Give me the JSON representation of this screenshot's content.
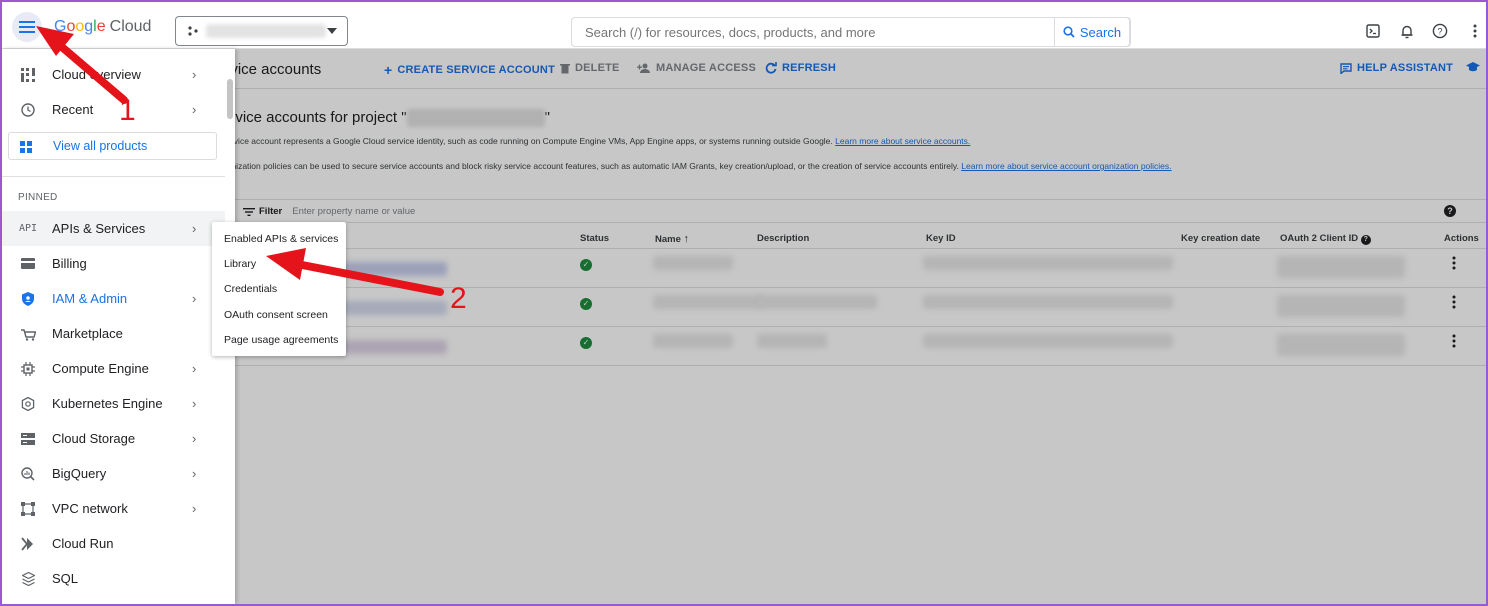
{
  "header": {
    "logo_google": [
      "G",
      "o",
      "o",
      "g",
      "l",
      "e"
    ],
    "logo_cloud": "Cloud",
    "search_placeholder": "Search (/) for resources, docs, products, and more",
    "search_button": "Search"
  },
  "toolbar": {
    "title": "ervice accounts",
    "create": "CREATE SERVICE ACCOUNT",
    "delete": "DELETE",
    "manage": "MANAGE ACCESS",
    "refresh": "REFRESH",
    "help": "HELP ASSISTANT"
  },
  "main": {
    "section_title": "ervice accounts for project \"",
    "section_title_end": "\"",
    "para1": "service account represents a Google Cloud service identity, such as code running on Compute Engine VMs, App Engine apps, or systems running outside Google.",
    "para1_link": "Learn more about service accounts.",
    "para2": "ganization policies can be used to secure service accounts and block risky service account features, such as automatic IAM Grants, key creation/upload, or the creation of service accounts entirely.",
    "para2_link": "Learn more about service account organization policies.",
    "filter_label": "Filter",
    "filter_placeholder": "Enter property name or value",
    "columns": [
      "Status",
      "Name",
      "Description",
      "Key ID",
      "Key creation date",
      "OAuth 2 Client ID",
      "Actions"
    ]
  },
  "drawer": {
    "items": [
      {
        "label": "Cloud overview",
        "icon": "dashboard-icon",
        "chevron": true
      },
      {
        "label": "Recent",
        "icon": "clock-icon",
        "chevron": true
      }
    ],
    "view_all": "View all products",
    "pinned_label": "PINNED",
    "pinned": [
      {
        "label": "APIs & Services",
        "icon": "api-icon",
        "chevron": true
      },
      {
        "label": "Billing",
        "icon": "billing-icon",
        "chevron": false
      },
      {
        "label": "IAM & Admin",
        "icon": "shield-icon",
        "chevron": true
      },
      {
        "label": "Marketplace",
        "icon": "cart-icon",
        "chevron": false
      },
      {
        "label": "Compute Engine",
        "icon": "chip-icon",
        "chevron": true
      },
      {
        "label": "Kubernetes Engine",
        "icon": "kubernetes-icon",
        "chevron": true
      },
      {
        "label": "Cloud Storage",
        "icon": "storage-icon",
        "chevron": true
      },
      {
        "label": "BigQuery",
        "icon": "bigquery-icon",
        "chevron": true
      },
      {
        "label": "VPC network",
        "icon": "network-icon",
        "chevron": true
      },
      {
        "label": "Cloud Run",
        "icon": "cloud-run-icon",
        "chevron": false
      },
      {
        "label": "SQL",
        "icon": "sql-icon",
        "chevron": false
      }
    ]
  },
  "submenu": {
    "items": [
      "Enabled APIs & services",
      "Library",
      "Credentials",
      "OAuth consent screen",
      "Page usage agreements"
    ]
  },
  "annotations": {
    "step1": "1",
    "step2": "2"
  },
  "colors": {
    "accent": "#1a73e8",
    "annotation": "#e5141b",
    "success": "#1e8e3e"
  }
}
